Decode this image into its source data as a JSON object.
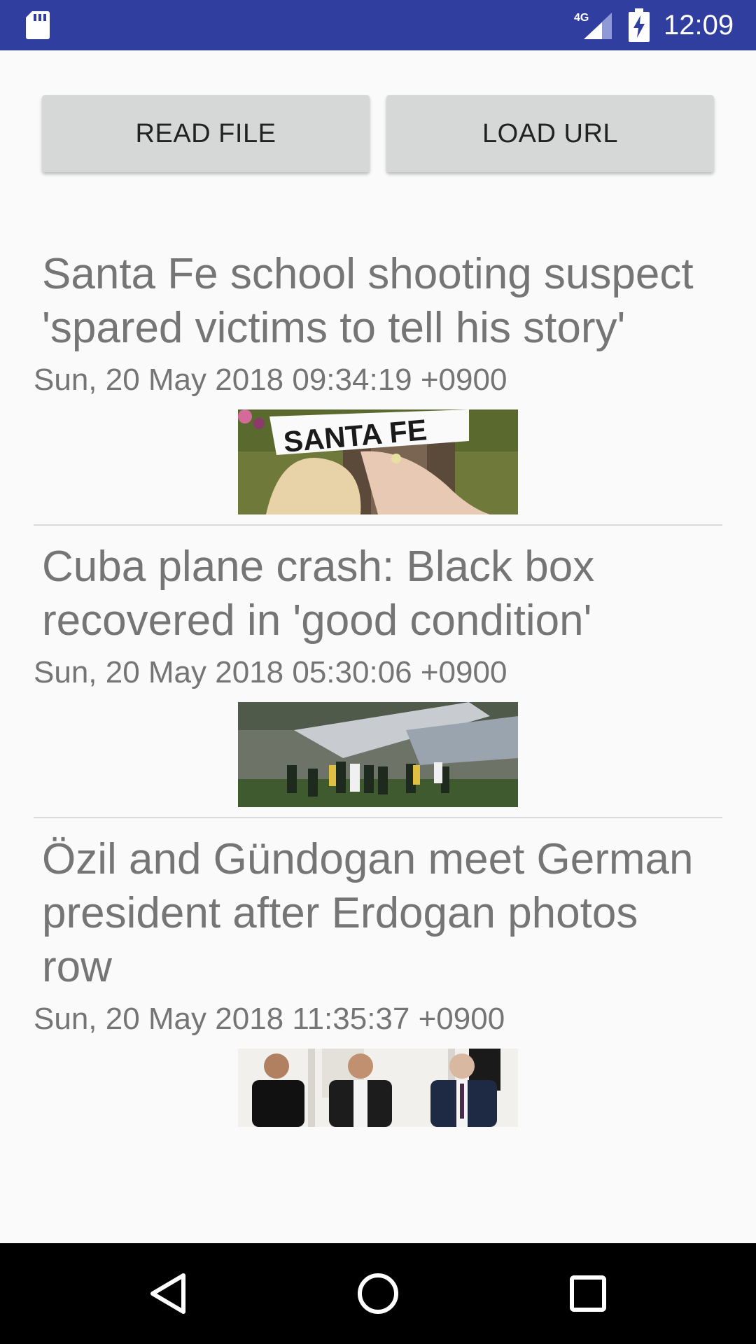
{
  "status_bar": {
    "network": "4G",
    "time": "12:09",
    "icons": [
      "sd-card-icon",
      "signal-icon",
      "battery-charging-icon"
    ]
  },
  "buttons": {
    "read_file": "READ FILE",
    "load_url": "LOAD URL"
  },
  "feed": [
    {
      "title": "Santa Fe school shooting suspect 'spared victims to tell his story'",
      "date": "Sun, 20 May 2018 09:34:19 +0900",
      "image_text": "SANTA FE"
    },
    {
      "title": "Cuba plane crash: Black box recovered in 'good condition'",
      "date": "Sun, 20 May 2018 05:30:06 +0900"
    },
    {
      "title": "Özil and Gündogan meet German president after Erdogan photos row",
      "date": "Sun, 20 May 2018 11:35:37 +0900"
    }
  ],
  "nav_bar": {
    "icons": [
      "back-icon",
      "home-icon",
      "recents-icon"
    ]
  }
}
